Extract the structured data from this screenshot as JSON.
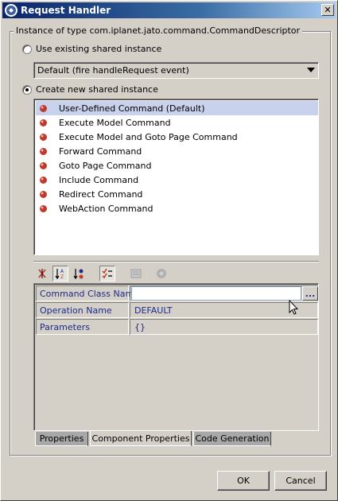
{
  "window": {
    "title": "Request Handler",
    "close_glyph": "✕"
  },
  "group": {
    "label": "Instance of type com.iplanet.jato.command.CommandDescriptor"
  },
  "existing": {
    "radio_label": "Use existing shared instance",
    "checked": false,
    "combo_value": "Default (fire handleRequest event)"
  },
  "create_new": {
    "radio_label": "Create new shared instance",
    "checked": true
  },
  "commands": [
    {
      "label": "User-Defined Command (Default)",
      "selected": true
    },
    {
      "label": "Execute Model Command",
      "selected": false
    },
    {
      "label": "Execute Model and Goto Page Command",
      "selected": false
    },
    {
      "label": "Forward Command",
      "selected": false
    },
    {
      "label": "Goto Page Command",
      "selected": false
    },
    {
      "label": "Include Command",
      "selected": false
    },
    {
      "label": "Redirect Command",
      "selected": false
    },
    {
      "label": "WebAction Command",
      "selected": false
    }
  ],
  "toolbar": {
    "icons": [
      "unsorted-icon",
      "sort-by-name-icon",
      "sort-by-type-icon",
      "properties-checklist-icon",
      "customizer-icon",
      "help-icon"
    ]
  },
  "properties": [
    {
      "name": "Command Class Name",
      "value": "",
      "editor": "text-with-ellipsis",
      "ellipsis": "..."
    },
    {
      "name": "Operation Name",
      "value": "DEFAULT"
    },
    {
      "name": "Parameters",
      "value": "{}"
    }
  ],
  "tabs": [
    {
      "label": "Properties",
      "active": false
    },
    {
      "label": "Component Properties",
      "active": true
    },
    {
      "label": "Code Generation",
      "active": false
    }
  ],
  "buttons": {
    "ok": "OK",
    "cancel": "Cancel"
  },
  "colors": {
    "title_bar": "#0a246a",
    "selection": "#c8d2ec",
    "property_text": "#1c2b8c",
    "command_icon": "#c0392b"
  }
}
